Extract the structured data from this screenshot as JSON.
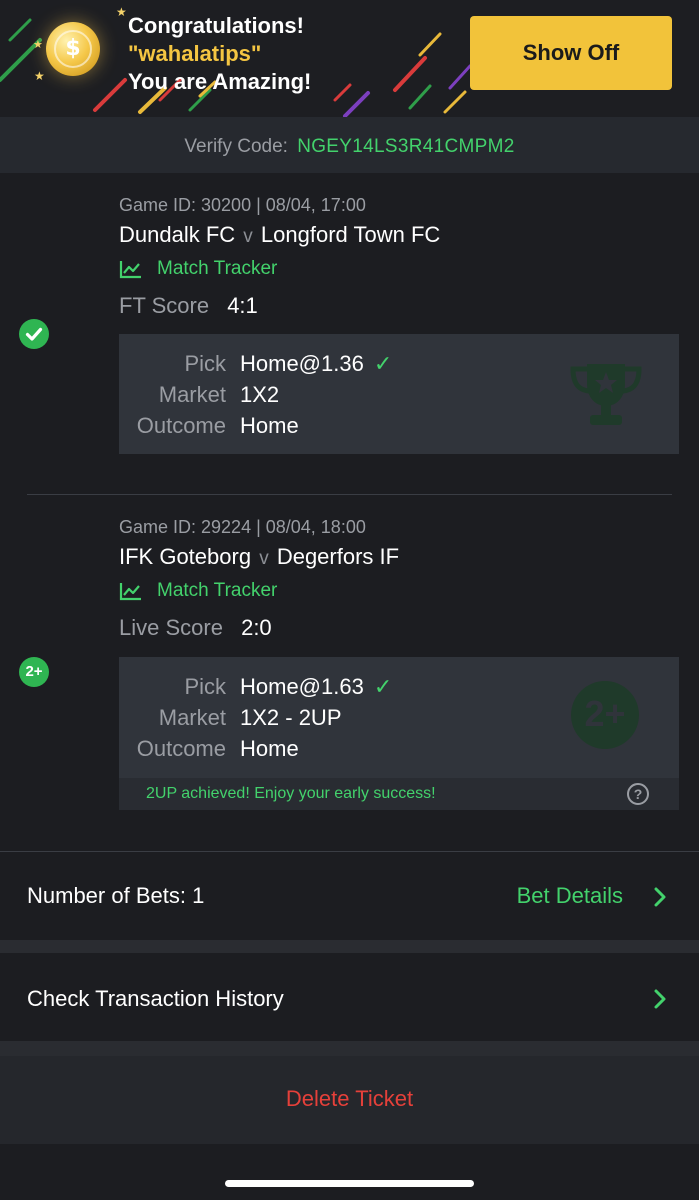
{
  "banner": {
    "line1": "Congratulations!",
    "username": "\"wahalatips\"",
    "line3": "You are Amazing!",
    "coin_symbol": "$",
    "show_off_label": "Show Off",
    "accent_color": "#f2c33a"
  },
  "verify": {
    "label": "Verify Code:",
    "code": "NGEY14LS3R41CMPM2"
  },
  "games": [
    {
      "meta": "Game ID: 30200 | 08/04, 17:00",
      "home": "Dundalk FC",
      "vs": "v",
      "away": "Longford Town FC",
      "tracker_label": "Match Tracker",
      "score_label": "FT Score",
      "score": "4:1",
      "status_icon": "check-circle-icon",
      "pick_label": "Pick",
      "pick": "Home@1.36",
      "market_label": "Market",
      "market": "1X2",
      "outcome_label": "Outcome",
      "outcome": "Home",
      "watermark_icon": "trophy-icon"
    },
    {
      "meta": "Game ID: 29224 | 08/04, 18:00",
      "home": "IFK Goteborg",
      "vs": "v",
      "away": "Degerfors IF",
      "tracker_label": "Match Tracker",
      "score_label": "Live Score",
      "score": "2:0",
      "status_icon": "two-up-icon",
      "status_badge_text": "2+",
      "pick_label": "Pick",
      "pick": "Home@1.63",
      "market_label": "Market",
      "market": "1X2 - 2UP",
      "outcome_label": "Outcome",
      "outcome": "Home",
      "note": "2UP achieved! Enjoy your early success!",
      "help_symbol": "?",
      "watermark_icon": "two-up-watermark-icon",
      "watermark_text": "2+"
    }
  ],
  "bets": {
    "label": "Number of Bets: 1",
    "link_label": "Bet Details"
  },
  "transactions": {
    "label": "Check Transaction History"
  },
  "delete_label": "Delete Ticket",
  "colors": {
    "green": "#43d26c",
    "red": "#e5403a",
    "background": "#1c1d21"
  }
}
